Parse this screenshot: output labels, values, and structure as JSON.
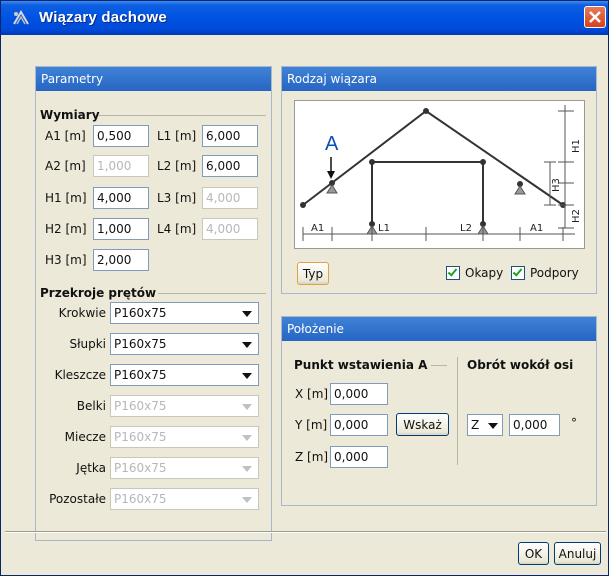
{
  "window": {
    "title": "Wiązary dachowe"
  },
  "parametry": {
    "header": "Parametry",
    "wymiary": {
      "heading": "Wymiary",
      "fields": [
        {
          "label": "A1 [m]",
          "value": "0,500",
          "enabled": true
        },
        {
          "label": "A2 [m]",
          "value": "1,000",
          "enabled": false
        },
        {
          "label": "H1 [m]",
          "value": "4,000",
          "enabled": true
        },
        {
          "label": "H2 [m]",
          "value": "1,000",
          "enabled": true
        },
        {
          "label": "H3 [m]",
          "value": "2,000",
          "enabled": true
        },
        {
          "label": "L1 [m]",
          "value": "6,000",
          "enabled": true
        },
        {
          "label": "L2 [m]",
          "value": "6,000",
          "enabled": true
        },
        {
          "label": "L3 [m]",
          "value": "4,000",
          "enabled": false
        },
        {
          "label": "L4 [m]",
          "value": "4,000",
          "enabled": false
        }
      ]
    },
    "przekroje": {
      "heading": "Przekroje prętów",
      "rows": [
        {
          "label": "Krokwie",
          "value": "P160x75",
          "enabled": true
        },
        {
          "label": "Słupki",
          "value": "P160x75",
          "enabled": true
        },
        {
          "label": "Kleszcze",
          "value": "P160x75",
          "enabled": true
        },
        {
          "label": "Belki",
          "value": "P160x75",
          "enabled": false
        },
        {
          "label": "Miecze",
          "value": "P160x75",
          "enabled": false
        },
        {
          "label": "Jętka",
          "value": "P160x75",
          "enabled": false
        },
        {
          "label": "Pozostałe",
          "value": "P160x75",
          "enabled": false
        }
      ]
    }
  },
  "rodzaj": {
    "header": "Rodzaj wiązara",
    "diagram_labels": {
      "a": "A",
      "h1": "H1",
      "h2": "H2",
      "h3": "H3",
      "l1": "L1",
      "l2": "L2",
      "a1_left": "A1",
      "a1_right": "A1"
    },
    "typ_button": "Typ",
    "okapy": {
      "label": "Okapy",
      "checked": true
    },
    "podpory": {
      "label": "Podpory",
      "checked": true
    }
  },
  "polozenie": {
    "header": "Położenie",
    "punkt_heading": "Punkt wstawienia A",
    "obrot_heading": "Obrót wokół osi",
    "x": {
      "label": "X [m]",
      "value": "0,000"
    },
    "y": {
      "label": "Y [m]",
      "value": "0,000"
    },
    "z": {
      "label": "Z [m]",
      "value": "0,000"
    },
    "wskaz_button": "Wskaż",
    "axis": "Z",
    "angle": "0,000",
    "angle_unit": "°"
  },
  "footer": {
    "ok": "OK",
    "cancel": "Anuluj"
  }
}
